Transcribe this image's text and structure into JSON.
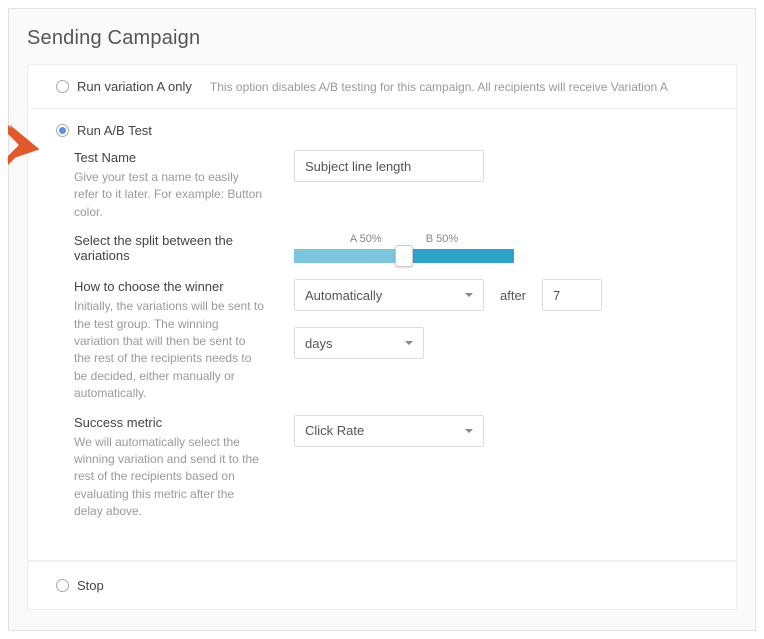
{
  "page": {
    "title": "Sending Campaign"
  },
  "variationA": {
    "label": "Run variation A only",
    "hint": "This option disables A/B testing for this campaign. All recipients will receive Variation A"
  },
  "abTest": {
    "label": "Run A/B Test",
    "testName": {
      "title": "Test Name",
      "desc": "Give your test a name to easily refer to it later. For example: Button color.",
      "value": "Subject line length"
    },
    "split": {
      "title": "Select the split between the variations",
      "labelA": "A 50%",
      "labelB": "B 50%"
    },
    "winner": {
      "title": "How to choose the winner",
      "desc": "Initially, the variations will be sent to the test group. The winning variation that will then be sent to the rest of the recipients needs to be decided, either manually or automatically.",
      "method": "Automatically",
      "afterLabel": "after",
      "delayValue": "7",
      "delayUnit": "days"
    },
    "metric": {
      "title": "Success metric",
      "desc": "We will automatically select the winning variation and send it to the rest of the recipients based on evaluating this metric after the delay above.",
      "value": "Click Rate"
    }
  },
  "stop": {
    "label": "Stop"
  }
}
